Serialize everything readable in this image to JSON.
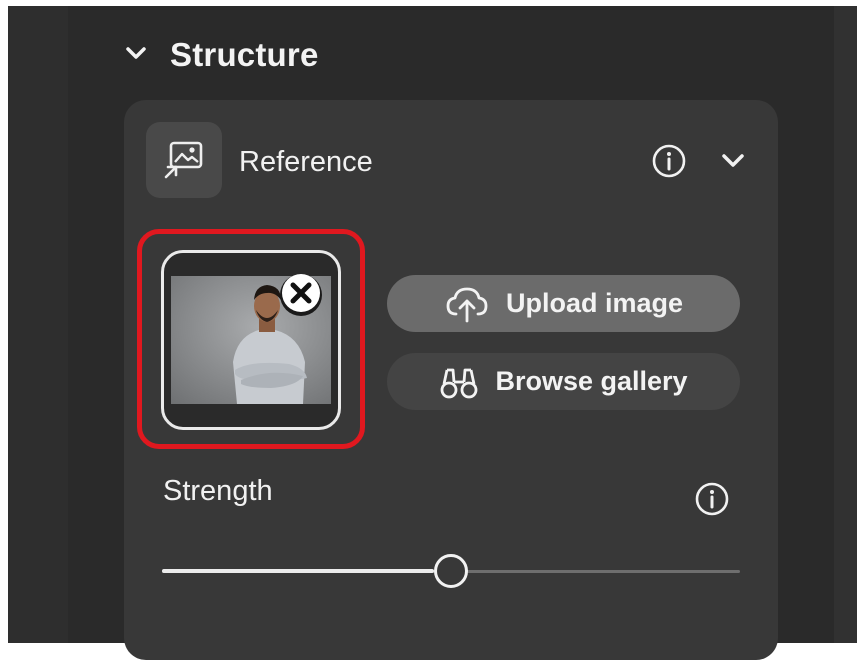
{
  "structure": {
    "title": "Structure",
    "collapse_icon": "chevron-down-icon"
  },
  "reference": {
    "label": "Reference",
    "icon": "image-reference-icon",
    "info_icon": "info-icon",
    "expand_icon": "chevron-down-icon",
    "thumbnail": {
      "subject": "man in grey sweater with arms crossed",
      "remove_icon": "close-icon"
    },
    "upload_label": "Upload image",
    "upload_icon": "cloud-upload-icon",
    "browse_label": "Browse gallery",
    "browse_icon": "binoculars-icon"
  },
  "strength": {
    "label": "Strength",
    "info_icon": "info-icon",
    "value_fraction": 0.5
  },
  "colors": {
    "highlight": "#e0181f",
    "panel": "#383838",
    "upload_button": "#6b6b6b",
    "browse_button": "#444444"
  }
}
